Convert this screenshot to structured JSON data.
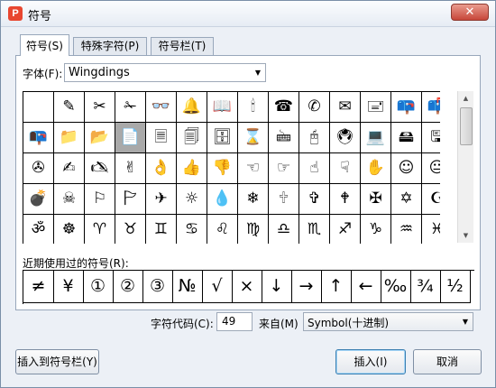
{
  "window": {
    "title": "符号",
    "app_icon": "wps-logo-icon",
    "close_glyph": "✕"
  },
  "tabs": [
    {
      "label": "符号(S)",
      "active": true
    },
    {
      "label": "特殊字符(P)",
      "active": false
    },
    {
      "label": "符号栏(T)",
      "active": false
    }
  ],
  "font": {
    "label": "字体(F):",
    "value": "Wingdings",
    "arrow": "▼"
  },
  "symbol_grid": {
    "selected_index": 18,
    "rows": [
      [
        " ",
        "✎",
        "✂",
        "✁",
        "👓",
        "🔔",
        "📖",
        "🕯",
        "☎",
        "✆",
        "✉",
        "🖃",
        "📪",
        "📫",
        "📬"
      ],
      [
        "📭",
        "📁",
        "📂",
        "📄",
        "🗏",
        "🗐",
        "🗄",
        "⌛",
        "🖮",
        "🖰",
        "🖲",
        "💻",
        "🖴",
        "🖫",
        "🖬"
      ],
      [
        "✇",
        "✍",
        "🖎",
        "✌",
        "👌",
        "👍",
        "👎",
        "☜",
        "☞",
        "☝",
        "☟",
        "✋",
        "☺",
        "😐",
        "☹"
      ],
      [
        "💣",
        "☠",
        "⚐",
        "🏱",
        "✈",
        "☼",
        "💧",
        "❄",
        "🕆",
        "✞",
        "🕈",
        "✠",
        "✡",
        "☪",
        "☯"
      ],
      [
        "ॐ",
        "☸",
        "♈",
        "♉",
        "♊",
        "♋",
        "♌",
        "♍",
        "♎",
        "♏",
        "♐",
        "♑",
        "♒",
        "♓",
        "er"
      ]
    ]
  },
  "scrollbar": {
    "up": "▲",
    "down": "▼"
  },
  "recent": {
    "label": "近期使用过的符号(R):",
    "symbols": [
      "≠",
      "¥",
      "①",
      "②",
      "③",
      "№",
      "√",
      "×",
      "↓",
      "→",
      "↑",
      "←",
      "‰",
      "¾",
      "½"
    ]
  },
  "char_code": {
    "label": "字符代码(C):",
    "value": "49"
  },
  "from": {
    "label": "来自(M)",
    "value": "Symbol(十进制)",
    "arrow": "▼"
  },
  "buttons": {
    "insert_to_bar": "插入到符号栏(Y)",
    "insert": "插入(I)",
    "cancel": "取消"
  },
  "colors": {
    "selected_cell": "#a9a9a9",
    "close_button": "#c7473a",
    "app_icon": "#e8462f"
  }
}
